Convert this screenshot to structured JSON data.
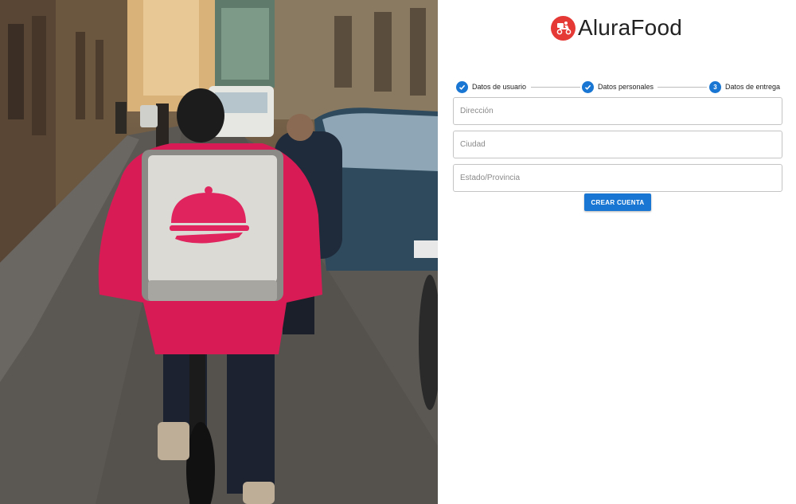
{
  "hero": {
    "image": "delivery-courier-on-bicycle-photo",
    "backpack_icon": "food-cloche-icon"
  },
  "brand": {
    "logo_icon": "delivery-scooter-icon",
    "name": "AluraFood",
    "logo_color": "#e53935"
  },
  "stepper": {
    "accent": "#1976d2",
    "steps": [
      {
        "label": "Datos de usuario",
        "state": "completed",
        "icon": "check-icon"
      },
      {
        "label": "Datos personales",
        "state": "completed",
        "icon": "check-icon"
      },
      {
        "label": "Datos de entrega",
        "state": "active",
        "number": "3"
      }
    ]
  },
  "form": {
    "fields": [
      {
        "placeholder": "Dirección",
        "value": ""
      },
      {
        "placeholder": "Ciudad",
        "value": ""
      },
      {
        "placeholder": "Estado/Provincia",
        "value": ""
      }
    ],
    "submit_label": "CREAR CUENTA"
  }
}
